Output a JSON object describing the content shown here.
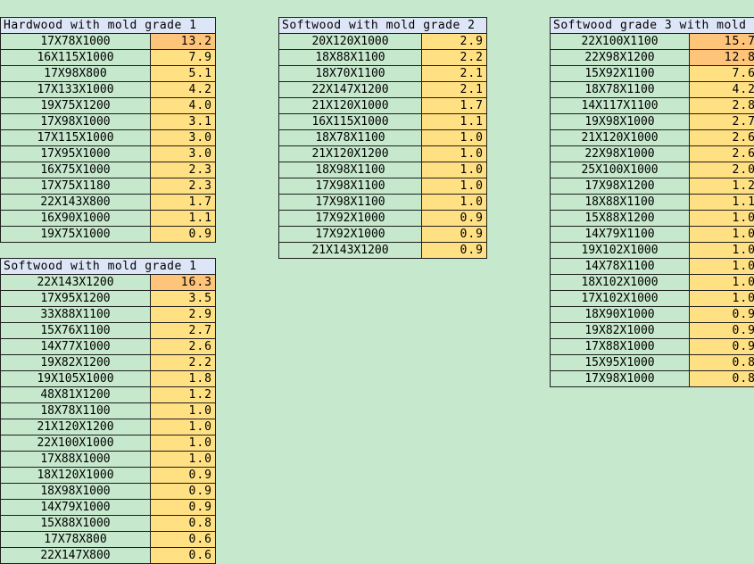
{
  "tables": [
    {
      "id": "hardwood-mold-grade-1",
      "title": "Hardwood with mold grade 1",
      "rows": [
        {
          "size": "17X78X1000",
          "value": "13.2",
          "highlight": true
        },
        {
          "size": "16X115X1000",
          "value": "7.9"
        },
        {
          "size": "17X98X800",
          "value": "5.1"
        },
        {
          "size": "17X133X1000",
          "value": "4.2"
        },
        {
          "size": "19X75X1200",
          "value": "4.0"
        },
        {
          "size": "17X98X1000",
          "value": "3.1"
        },
        {
          "size": "17X115X1000",
          "value": "3.0"
        },
        {
          "size": "17X95X1000",
          "value": "3.0"
        },
        {
          "size": "16X75X1000",
          "value": "2.3"
        },
        {
          "size": "17X75X1180",
          "value": "2.3"
        },
        {
          "size": "22X143X800",
          "value": "1.7"
        },
        {
          "size": "16X90X1000",
          "value": "1.1"
        },
        {
          "size": "19X75X1000",
          "value": "0.9"
        }
      ]
    },
    {
      "id": "softwood-mold-grade-1",
      "title": "Softwood with mold grade 1",
      "rows": [
        {
          "size": "22X143X1200",
          "value": "16.3",
          "highlight": true
        },
        {
          "size": "17X95X1200",
          "value": "3.5"
        },
        {
          "size": "33X88X1100",
          "value": "2.9"
        },
        {
          "size": "15X76X1100",
          "value": "2.7"
        },
        {
          "size": "14X77X1000",
          "value": "2.6"
        },
        {
          "size": "19X82X1200",
          "value": "2.2"
        },
        {
          "size": "19X105X1000",
          "value": "1.8"
        },
        {
          "size": "48X81X1200",
          "value": "1.2"
        },
        {
          "size": "18X78X1100",
          "value": "1.0"
        },
        {
          "size": "21X120X1200",
          "value": "1.0"
        },
        {
          "size": "22X100X1000",
          "value": "1.0"
        },
        {
          "size": "17X88X1000",
          "value": "1.0"
        },
        {
          "size": "18X120X1000",
          "value": "0.9"
        },
        {
          "size": "18X98X1000",
          "value": "0.9"
        },
        {
          "size": "14X79X1000",
          "value": "0.9"
        },
        {
          "size": "15X88X1000",
          "value": "0.8"
        },
        {
          "size": "17X78X800",
          "value": "0.6"
        },
        {
          "size": "22X147X800",
          "value": "0.6"
        }
      ]
    },
    {
      "id": "softwood-mold-grade-2",
      "title": "Softwood with mold grade 2",
      "rows": [
        {
          "size": "20X120X1000",
          "value": "2.9"
        },
        {
          "size": "18X88X1100",
          "value": "2.2"
        },
        {
          "size": "18X70X1100",
          "value": "2.1"
        },
        {
          "size": "22X147X1200",
          "value": "2.1"
        },
        {
          "size": "21X120X1000",
          "value": "1.7"
        },
        {
          "size": "16X115X1000",
          "value": "1.1"
        },
        {
          "size": "18X78X1100",
          "value": "1.0"
        },
        {
          "size": "21X120X1200",
          "value": "1.0"
        },
        {
          "size": "18X98X1100",
          "value": "1.0"
        },
        {
          "size": "17X98X1100",
          "value": "1.0"
        },
        {
          "size": "17X98X1100",
          "value": "1.0"
        },
        {
          "size": "17X92X1000",
          "value": "0.9"
        },
        {
          "size": "17X92X1000",
          "value": "0.9"
        },
        {
          "size": "21X143X1200",
          "value": "0.9"
        }
      ]
    },
    {
      "id": "softwood-grade-3-mold",
      "title": "Softwood grade 3 with mold",
      "rows": [
        {
          "size": "22X100X1100",
          "value": "15.7",
          "highlight": true
        },
        {
          "size": "22X98X1200",
          "value": "12.8",
          "highlight": true
        },
        {
          "size": "15X92X1100",
          "value": "7.6"
        },
        {
          "size": "18X78X1100",
          "value": "4.2"
        },
        {
          "size": "14X117X1100",
          "value": "2.8"
        },
        {
          "size": "19X98X1000",
          "value": "2.7"
        },
        {
          "size": "21X120X1000",
          "value": "2.6"
        },
        {
          "size": "22X98X1000",
          "value": "2.6"
        },
        {
          "size": "25X100X1000",
          "value": "2.0"
        },
        {
          "size": "17X98X1200",
          "value": "1.2"
        },
        {
          "size": "18X88X1100",
          "value": "1.1"
        },
        {
          "size": "15X88X1200",
          "value": "1.0"
        },
        {
          "size": "14X79X1100",
          "value": "1.0"
        },
        {
          "size": "19X102X1000",
          "value": "1.0"
        },
        {
          "size": "14X78X1100",
          "value": "1.0"
        },
        {
          "size": "18X102X1000",
          "value": "1.0"
        },
        {
          "size": "17X102X1000",
          "value": "1.0"
        },
        {
          "size": "18X90X1000",
          "value": "0.9"
        },
        {
          "size": "19X82X1000",
          "value": "0.9"
        },
        {
          "size": "17X88X1000",
          "value": "0.9"
        },
        {
          "size": "15X95X1000",
          "value": "0.8"
        },
        {
          "size": "17X98X1000",
          "value": "0.8"
        }
      ]
    }
  ]
}
